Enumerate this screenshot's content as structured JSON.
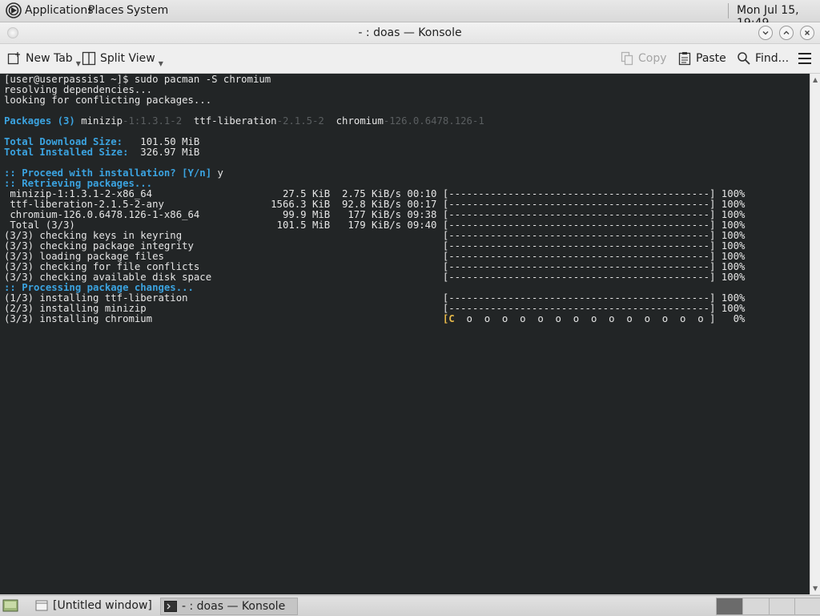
{
  "top_panel": {
    "menus": [
      "Applications",
      "Places",
      "System"
    ],
    "clock": "Mon Jul 15, 19:49"
  },
  "window": {
    "title": "- : doas — Konsole"
  },
  "toolbar": {
    "new_tab": "New Tab",
    "split_view": "Split View",
    "copy": "Copy",
    "paste": "Paste",
    "find": "Find..."
  },
  "terminal": {
    "lines": [
      {
        "text": "[user@userpassis1 ~]$ sudo pacman -S chromium"
      },
      {
        "text": "resolving dependencies..."
      },
      {
        "text": "looking for conflicting packages..."
      },
      {
        "text": ""
      },
      {
        "parts": [
          {
            "t": "Packages (3) ",
            "c": "b"
          },
          {
            "t": "minizip"
          },
          {
            "t": "-1:1.3.1-2",
            "c": "g"
          },
          {
            "t": "  ttf-liberation"
          },
          {
            "t": "-2.1.5-2",
            "c": "g"
          },
          {
            "t": "  chromium"
          },
          {
            "t": "-126.0.6478.126-1",
            "c": "g"
          }
        ]
      },
      {
        "text": ""
      },
      {
        "parts": [
          {
            "t": "Total Download Size:",
            "c": "b"
          },
          {
            "t": "   101.50 MiB"
          }
        ]
      },
      {
        "parts": [
          {
            "t": "Total Installed Size:",
            "c": "b"
          },
          {
            "t": "  326.97 MiB"
          }
        ]
      },
      {
        "text": ""
      },
      {
        "parts": [
          {
            "t": ":: Proceed with installation? [Y/n]",
            "c": "b"
          },
          {
            "t": " y"
          }
        ]
      },
      {
        "parts": [
          {
            "t": ":: Retrieving packages...",
            "c": "b"
          }
        ]
      },
      {
        "text": " minizip-1:1.3.1-2-x86_64                      27.5 KiB  2.75 KiB/s 00:10 [--------------------------------------------] 100%"
      },
      {
        "text": " ttf-liberation-2.1.5-2-any                  1566.3 KiB  92.8 KiB/s 00:17 [--------------------------------------------] 100%"
      },
      {
        "text": " chromium-126.0.6478.126-1-x86_64              99.9 MiB   177 KiB/s 09:38 [--------------------------------------------] 100%"
      },
      {
        "text": " Total (3/3)                                  101.5 MiB   179 KiB/s 09:40 [--------------------------------------------] 100%"
      },
      {
        "text": "(3/3) checking keys in keyring                                            [--------------------------------------------] 100%"
      },
      {
        "text": "(3/3) checking package integrity                                          [--------------------------------------------] 100%"
      },
      {
        "text": "(3/3) loading package files                                               [--------------------------------------------] 100%"
      },
      {
        "text": "(3/3) checking for file conflicts                                         [--------------------------------------------] 100%"
      },
      {
        "text": "(3/3) checking available disk space                                       [--------------------------------------------] 100%"
      },
      {
        "parts": [
          {
            "t": ":: Processing package changes...",
            "c": "b"
          }
        ]
      },
      {
        "text": "(1/3) installing ttf-liberation                                           [--------------------------------------------] 100%"
      },
      {
        "text": "(2/3) installing minizip                                                  [--------------------------------------------] 100%"
      },
      {
        "parts": [
          {
            "t": "(3/3) installing chromium                                                 "
          },
          {
            "t": "[C",
            "c": "y"
          },
          {
            "t": "  o  o  o  o  o  o  o  o  o  o  o  o  o  o ]   0%"
          }
        ]
      }
    ]
  },
  "taskbar": {
    "tasks": [
      {
        "label": "[Untitled window]"
      },
      {
        "label": "- : doas — Konsole"
      }
    ]
  },
  "colors": {
    "terminal_bg": "#222526",
    "accent_blue": "#3ba3e0",
    "pacman_yellow": "#e6b84a"
  }
}
